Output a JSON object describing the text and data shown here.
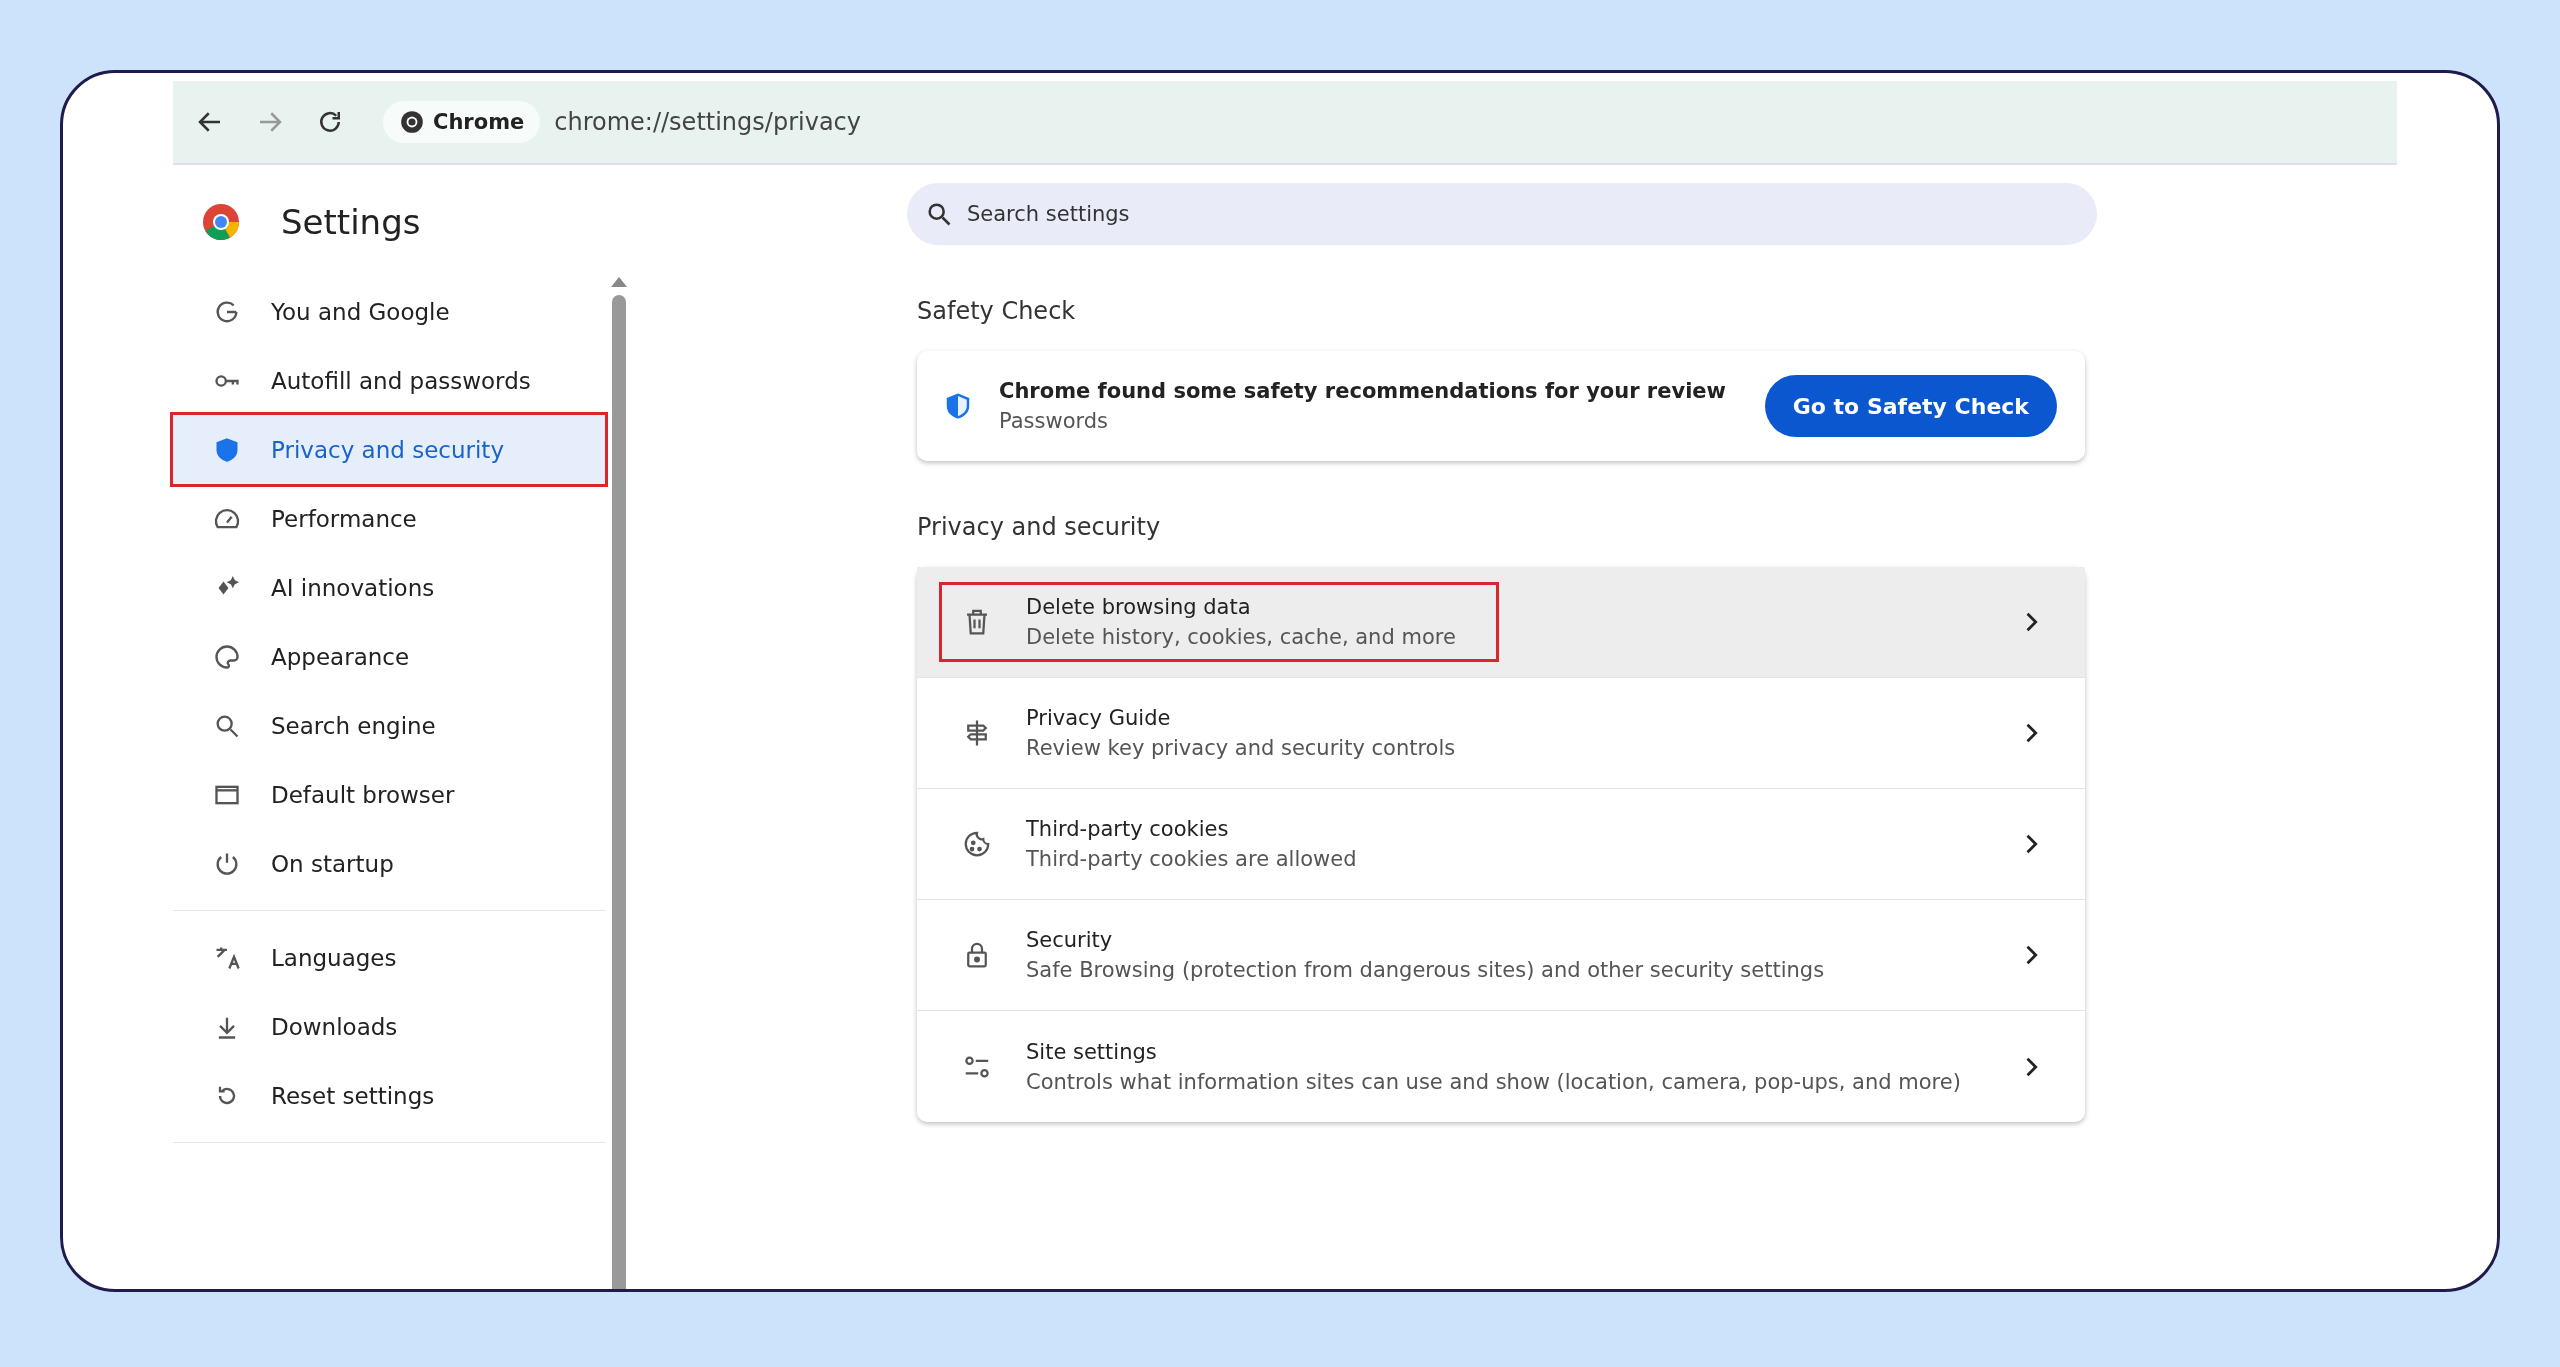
{
  "toolbar": {
    "site_chip": "Chrome",
    "address": "chrome://settings/privacy"
  },
  "app_title": "Settings",
  "search": {
    "placeholder": "Search settings"
  },
  "sidebar": {
    "groups": [
      {
        "items": [
          {
            "label": "You and Google",
            "selected": false,
            "highlighted": false
          },
          {
            "label": "Autofill and passwords",
            "selected": false,
            "highlighted": false
          },
          {
            "label": "Privacy and security",
            "selected": true,
            "highlighted": true
          },
          {
            "label": "Performance",
            "selected": false,
            "highlighted": false
          },
          {
            "label": "AI innovations",
            "selected": false,
            "highlighted": false
          },
          {
            "label": "Appearance",
            "selected": false,
            "highlighted": false
          },
          {
            "label": "Search engine",
            "selected": false,
            "highlighted": false
          },
          {
            "label": "Default browser",
            "selected": false,
            "highlighted": false
          },
          {
            "label": "On startup",
            "selected": false,
            "highlighted": false
          }
        ]
      },
      {
        "items": [
          {
            "label": "Languages",
            "selected": false,
            "highlighted": false
          },
          {
            "label": "Downloads",
            "selected": false,
            "highlighted": false
          },
          {
            "label": "Reset settings",
            "selected": false,
            "highlighted": false
          }
        ]
      }
    ]
  },
  "safety_check": {
    "heading": "Safety Check",
    "title": "Chrome found some safety recommendations for your review",
    "subtitle": "Passwords",
    "button": "Go to Safety Check"
  },
  "privacy": {
    "heading": "Privacy and security",
    "rows": [
      {
        "title": "Delete browsing data",
        "subtitle": "Delete history, cookies, cache, and more",
        "hovered": true,
        "highlighted": true
      },
      {
        "title": "Privacy Guide",
        "subtitle": "Review key privacy and security controls",
        "hovered": false,
        "highlighted": false
      },
      {
        "title": "Third-party cookies",
        "subtitle": "Third-party cookies are allowed",
        "hovered": false,
        "highlighted": false
      },
      {
        "title": "Security",
        "subtitle": "Safe Browsing (protection from dangerous sites) and other security settings",
        "hovered": false,
        "highlighted": false
      },
      {
        "title": "Site settings",
        "subtitle": "Controls what information sites can use and show (location, camera, pop-ups, and more)",
        "hovered": false,
        "highlighted": false
      }
    ]
  }
}
